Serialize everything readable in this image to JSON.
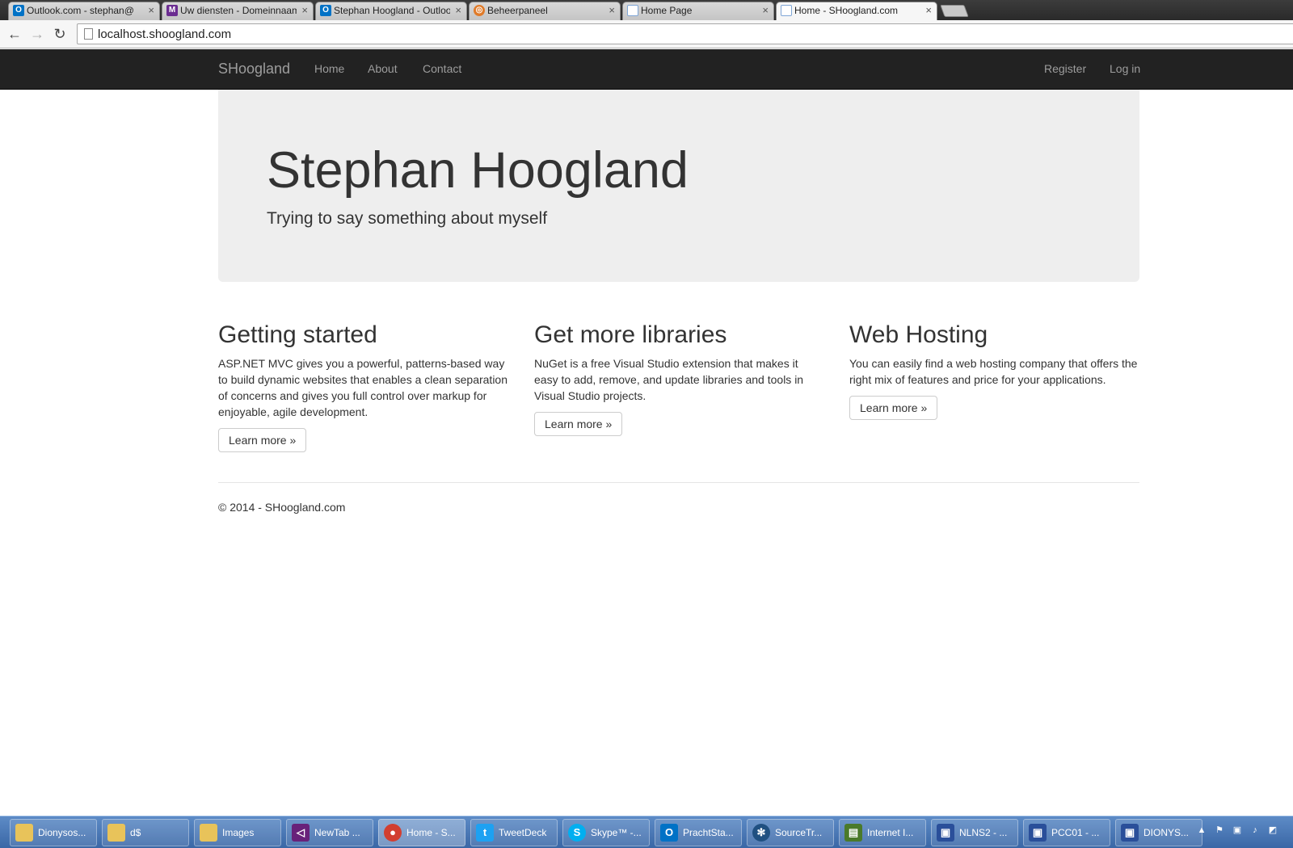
{
  "browser": {
    "tabs": [
      {
        "title": "Outlook.com - stephan@",
        "icon": "outlook-icon",
        "color": "#0072c6",
        "glyph": "O"
      },
      {
        "title": "Uw diensten - Domeinnaam",
        "icon": "m-icon",
        "color": "#6b2c91",
        "glyph": "M"
      },
      {
        "title": "Stephan Hoogland - Outlook",
        "icon": "outlook-icon",
        "color": "#0072c6",
        "glyph": "O"
      },
      {
        "title": "Beheerpaneel",
        "icon": "globe-icon",
        "color": "#e07b2a",
        "glyph": "◎"
      },
      {
        "title": "Home Page",
        "icon": "page-icon",
        "color": "#7fa6d6",
        "glyph": ""
      },
      {
        "title": "Home - SHoogland.com",
        "icon": "page-icon",
        "color": "#7fa6d6",
        "glyph": ""
      }
    ],
    "url": "localhost.shoogland.com"
  },
  "site": {
    "brand": "SHoogland",
    "nav_left": [
      "Home",
      "About",
      "Contact"
    ],
    "nav_right": [
      "Register",
      "Log in"
    ],
    "hero_title": "Stephan Hoogland",
    "hero_lead": "Trying to say something about myself",
    "columns": [
      {
        "heading": "Getting started",
        "text": "ASP.NET MVC gives you a powerful, patterns-based way to build dynamic websites that enables a clean separation of concerns and gives you full control over markup for enjoyable, agile development.",
        "button": "Learn more »"
      },
      {
        "heading": "Get more libraries",
        "text": "NuGet is a free Visual Studio extension that makes it easy to add, remove, and update libraries and tools in Visual Studio projects.",
        "button": "Learn more »"
      },
      {
        "heading": "Web Hosting",
        "text": "You can easily find a web hosting company that offers the right mix of features and price for your applications.",
        "button": "Learn more »"
      }
    ],
    "footer": "© 2014 - SHoogland.com"
  },
  "taskbar": {
    "items": [
      {
        "label": "Dionysos...",
        "icon": "folder-icon",
        "color": "#e8c35a",
        "glyph": "▮"
      },
      {
        "label": "d$",
        "icon": "network-drive-icon",
        "color": "#e8c35a",
        "glyph": "▮"
      },
      {
        "label": "Images",
        "icon": "folder-icon",
        "color": "#e8c35a",
        "glyph": "▮"
      },
      {
        "label": "NewTab ...",
        "icon": "visual-studio-icon",
        "color": "#68217a",
        "glyph": "◁"
      },
      {
        "label": "Home - S...",
        "icon": "chrome-icon",
        "color": "#d23f31",
        "glyph": "●"
      },
      {
        "label": "TweetDeck",
        "icon": "tweetdeck-icon",
        "color": "#1da1f2",
        "glyph": "t"
      },
      {
        "label": "Skype™ -...",
        "icon": "skype-icon",
        "color": "#00aff0",
        "glyph": "S"
      },
      {
        "label": "PrachtSta...",
        "icon": "outlook-icon",
        "color": "#0072c6",
        "glyph": "O"
      },
      {
        "label": "SourceTr...",
        "icon": "sourcetree-icon",
        "color": "#205081",
        "glyph": "✻"
      },
      {
        "label": "Internet I...",
        "icon": "iis-icon",
        "color": "#4a7a2a",
        "glyph": "▤"
      },
      {
        "label": "NLNS2 - ...",
        "icon": "remote-desktop-icon",
        "color": "#2a4f9a",
        "glyph": "▣"
      },
      {
        "label": "PCC01 - ...",
        "icon": "remote-desktop-icon",
        "color": "#2a4f9a",
        "glyph": "▣"
      },
      {
        "label": "DIONYS...",
        "icon": "remote-desktop-icon",
        "color": "#2a4f9a",
        "glyph": "▣"
      }
    ],
    "active_index": 4
  }
}
